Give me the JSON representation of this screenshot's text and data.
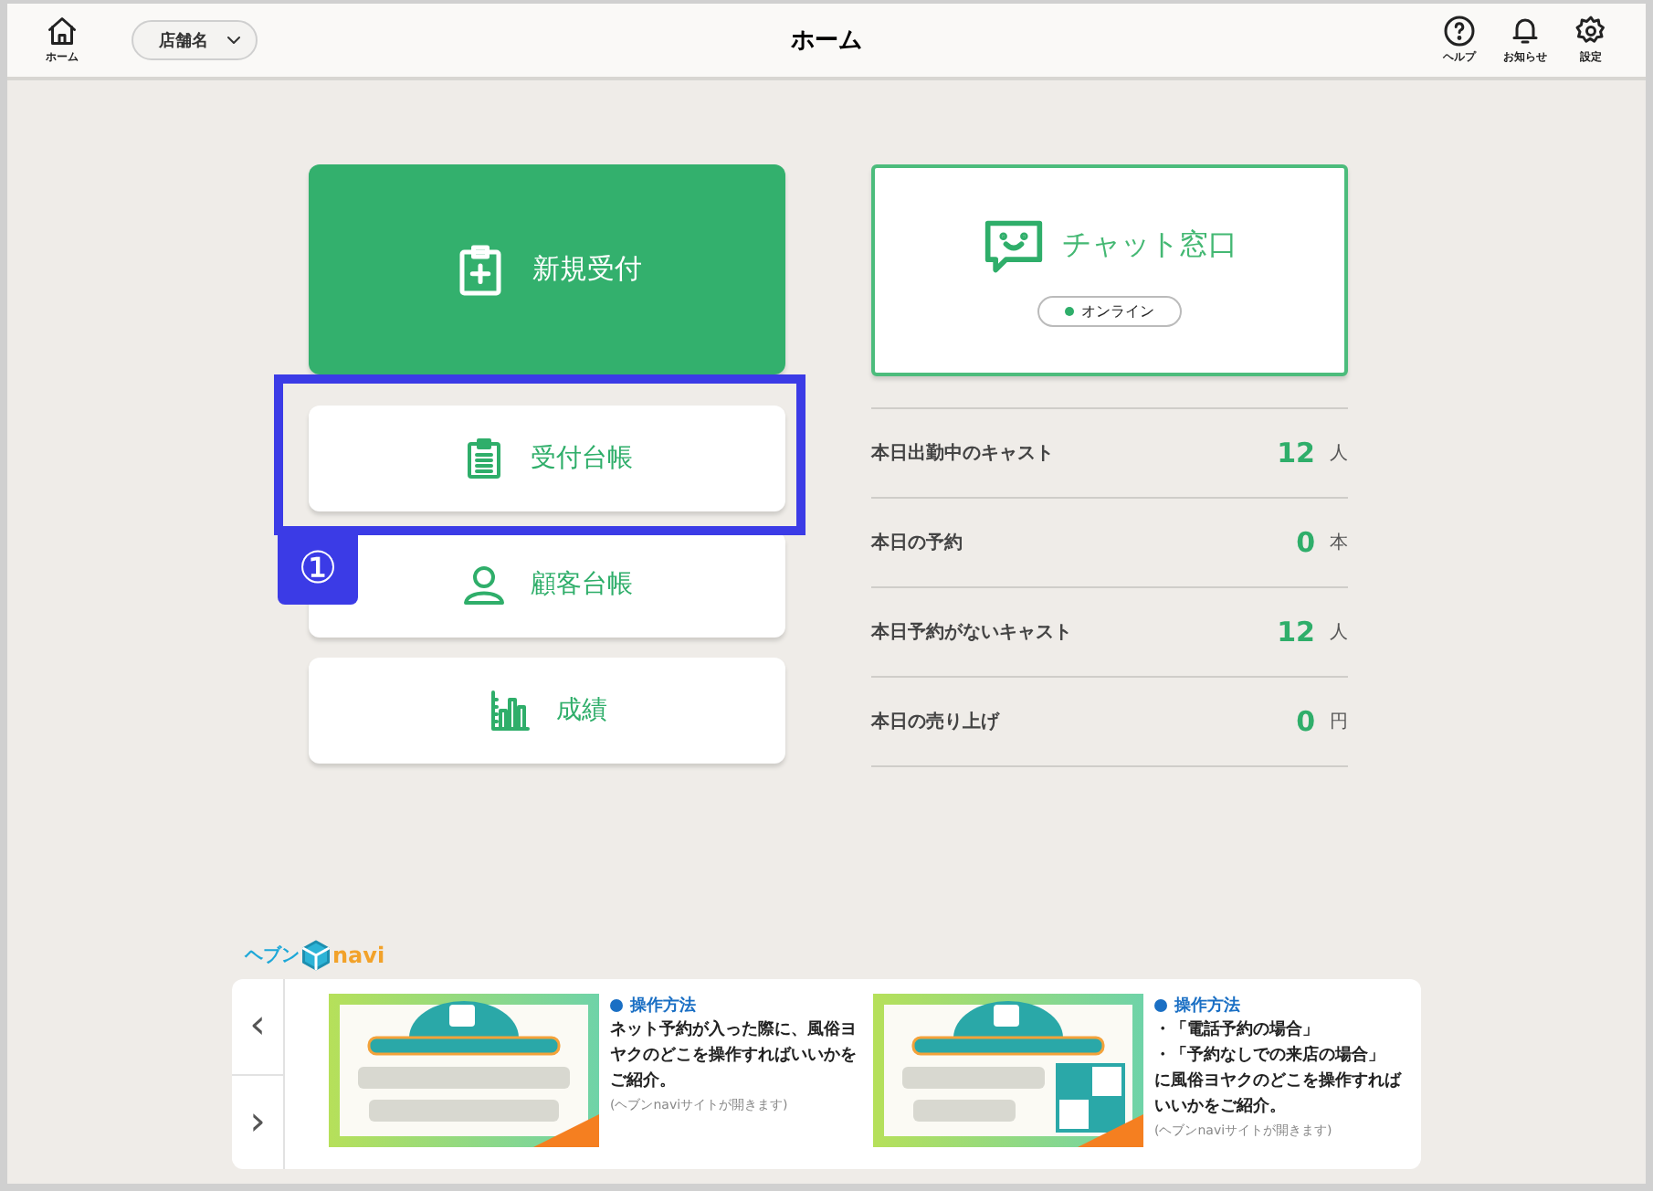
{
  "header": {
    "home_label": "ホーム",
    "store_select": {
      "value": "店舗名"
    },
    "title": "ホーム",
    "actions": [
      {
        "kind": "help",
        "label": "ヘルプ"
      },
      {
        "kind": "bell",
        "label": "お知らせ"
      },
      {
        "kind": "gear",
        "label": "設定"
      }
    ]
  },
  "menu": [
    {
      "kind": "new",
      "label": "新規受付",
      "primary": true
    },
    {
      "kind": "ledger",
      "label": "受付台帳",
      "primary": false,
      "highlighted": true
    },
    {
      "kind": "customer",
      "label": "顧客台帳",
      "primary": false
    },
    {
      "kind": "results",
      "label": "成績",
      "primary": false
    }
  ],
  "callout": {
    "label": "①"
  },
  "chat": {
    "title": "チャット窓口",
    "status": "オンライン",
    "online": true
  },
  "stats": [
    {
      "label": "本日出勤中のキャスト",
      "value": "12",
      "unit": "人"
    },
    {
      "label": "本日の予約",
      "value": "0",
      "unit": "本"
    },
    {
      "label": "本日予約がないキャスト",
      "value": "12",
      "unit": "人"
    },
    {
      "label": "本日の売り上げ",
      "value": "0",
      "unit": "円"
    }
  ],
  "navi": {
    "logo_prefix": "ヘブン",
    "logo_suffix": "navi",
    "prev": "‹",
    "next": "›",
    "items": [
      {
        "kind": "picture",
        "heading": "操作方法",
        "lines": [
          "ネット予約が入った際に、風俗ヨヤクのどこを操作すればいいかをご紹介。"
        ],
        "note": "(ヘブンnaviサイトが開きます)"
      },
      {
        "kind": "picture",
        "heading": "操作方法",
        "lines": [
          "・「電話予約の場合」",
          "・「予約なしでの来店の場合」",
          "に風俗ヨヤクのどこを操作すればいいかをご紹介。"
        ],
        "note": "(ヘブンnaviサイトが開きます)"
      }
    ]
  }
}
